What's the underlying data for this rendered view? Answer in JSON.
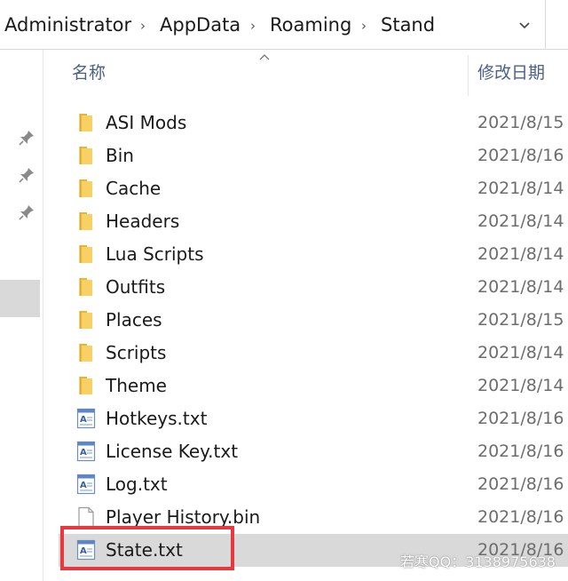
{
  "breadcrumb": {
    "items": [
      "Administrator",
      "AppData",
      "Roaming",
      "Stand"
    ],
    "separator": "›"
  },
  "columns": {
    "name": "名称",
    "date_modified": "修改日期"
  },
  "files": [
    {
      "name": "ASI Mods",
      "date": "2021/8/15",
      "type": "folder",
      "icon": "folder-icon"
    },
    {
      "name": "Bin",
      "date": "2021/8/16",
      "type": "folder",
      "icon": "folder-icon"
    },
    {
      "name": "Cache",
      "date": "2021/8/14",
      "type": "folder",
      "icon": "folder-icon"
    },
    {
      "name": "Headers",
      "date": "2021/8/14",
      "type": "folder",
      "icon": "folder-icon"
    },
    {
      "name": "Lua Scripts",
      "date": "2021/8/14",
      "type": "folder",
      "icon": "folder-icon"
    },
    {
      "name": "Outfits",
      "date": "2021/8/14",
      "type": "folder",
      "icon": "folder-icon"
    },
    {
      "name": "Places",
      "date": "2021/8/15",
      "type": "folder",
      "icon": "folder-icon"
    },
    {
      "name": "Scripts",
      "date": "2021/8/14",
      "type": "folder",
      "icon": "folder-icon"
    },
    {
      "name": "Theme",
      "date": "2021/8/14",
      "type": "folder",
      "icon": "folder-icon"
    },
    {
      "name": "Hotkeys.txt",
      "date": "2021/8/16",
      "type": "txt",
      "icon": "text-file-icon"
    },
    {
      "name": "License Key.txt",
      "date": "2021/8/16",
      "type": "txt",
      "icon": "text-file-icon"
    },
    {
      "name": "Log.txt",
      "date": "2021/8/16",
      "type": "txt",
      "icon": "text-file-icon"
    },
    {
      "name": "Player History.bin",
      "date": "2021/8/16",
      "type": "bin",
      "icon": "blank-file-icon"
    },
    {
      "name": "State.txt",
      "date": "2021/8/16",
      "type": "txt",
      "icon": "text-file-icon",
      "selected": true
    }
  ],
  "watermark": "若寒QQ：3138975638",
  "colors": {
    "selection": "#d9d9d9",
    "highlight_border": "#e8383d",
    "header_text": "#4d6185",
    "folder": "#f5c542"
  },
  "icons": {
    "pin": "pin-icon",
    "dropdown": "chevron-down-icon",
    "sort": "sort-up-icon"
  }
}
